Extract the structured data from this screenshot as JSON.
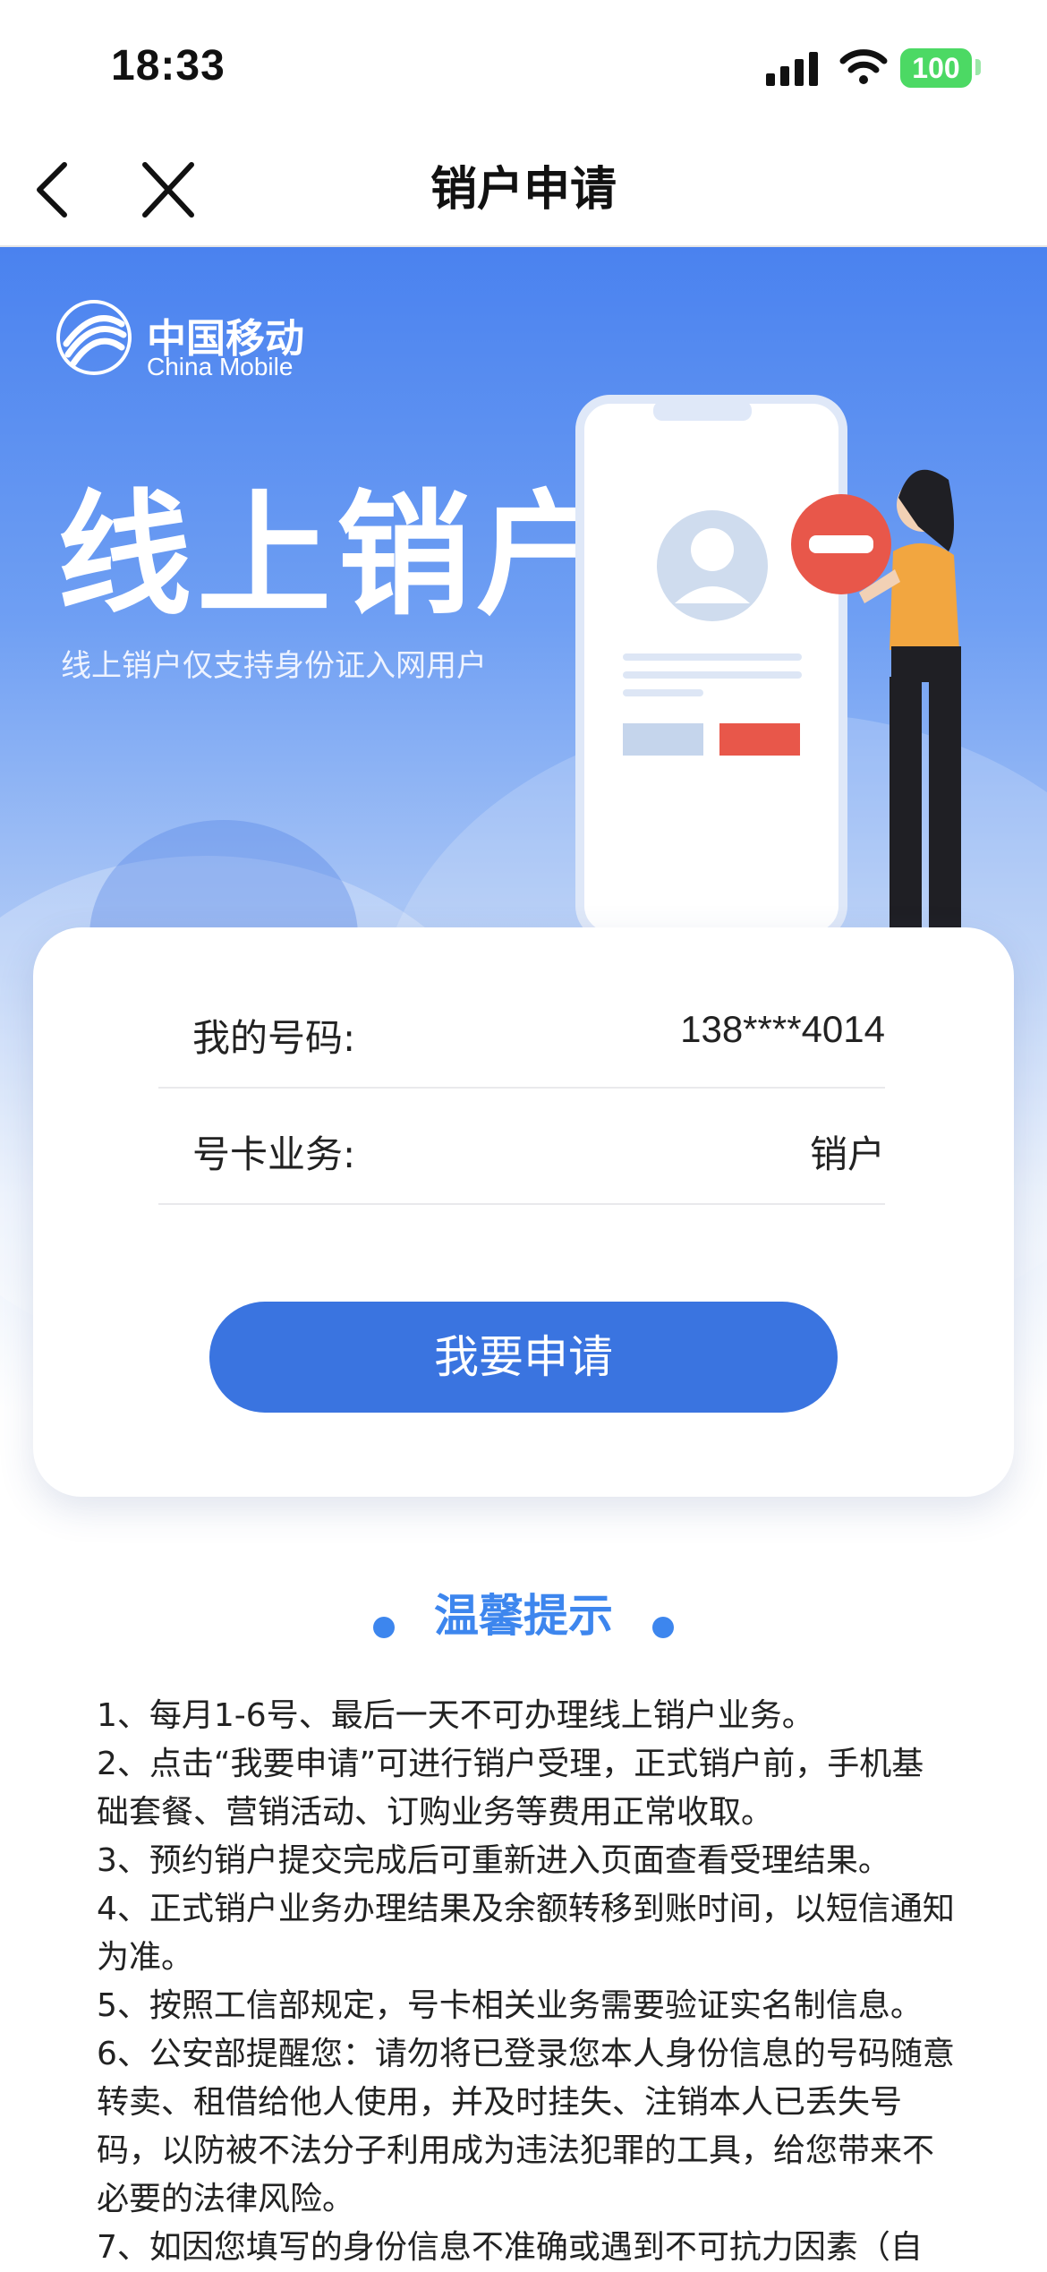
{
  "status_bar": {
    "time": "18:33",
    "battery": "100"
  },
  "nav": {
    "title": "销户申请"
  },
  "hero": {
    "logo_cn": "中国移动",
    "logo_en": "China Mobile",
    "title": "线上销户",
    "subtitle": "线上销户仅支持身份证入网用户"
  },
  "card": {
    "phone_label": "我的号码:",
    "phone_value": "138****4014",
    "service_label": "号卡业务:",
    "service_value": "销户",
    "apply_button": "我要申请"
  },
  "tips": {
    "title": "温馨提示",
    "items": [
      "1、每月1-6号、最后一天不可办理线上销户业务。",
      "2、点击“我要申请”可进行销户受理，正式销户前，手机基础套餐、营销活动、订购业务等费用正常收取。",
      "3、预约销户提交完成后可重新进入页面查看受理结果。",
      "4、正式销户业务办理结果及余额转移到账时间，以短信通知为准。",
      "5、按照工信部规定，号卡相关业务需要验证实名制信息。",
      "6、公安部提醒您：请勿将已登录您本人身份信息的号码随意转卖、租借给他人使用，并及时挂失、注销本人已丢失号码，以防被不法分子利用成为违法犯罪的工具，给您带来不必要的法律风险。",
      "7、如因您填写的身份信息不准确或遇到不可抗力因素（自"
    ]
  },
  "colors": {
    "primary": "#3a74e0",
    "tips_accent": "#3d86ee",
    "battery": "#4cd964"
  }
}
